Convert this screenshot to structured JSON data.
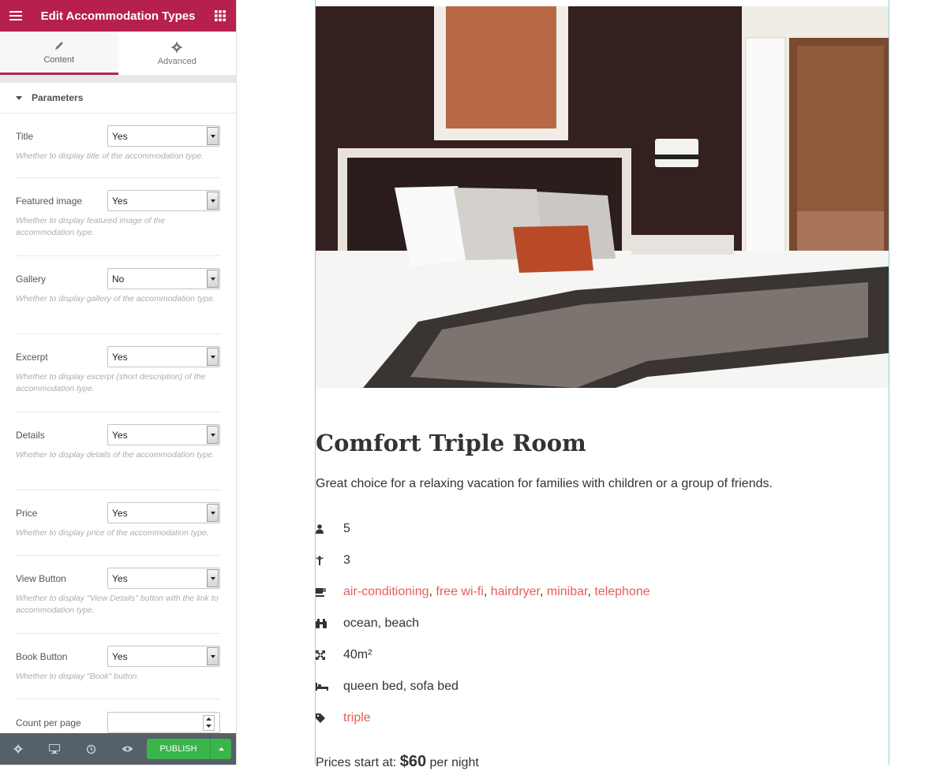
{
  "panel": {
    "title": "Edit Accommodation Types",
    "tabs": [
      {
        "label": "Content",
        "icon": "pencil-icon"
      },
      {
        "label": "Advanced",
        "icon": "gear-icon"
      }
    ],
    "section": "Parameters",
    "controls": [
      {
        "label": "Title",
        "value": "Yes",
        "desc": "Whether to display title of the accommodation type."
      },
      {
        "label": "Featured image",
        "value": "Yes",
        "desc": "Whether to display featured image of the accommodation type."
      },
      {
        "label": "Gallery",
        "value": "No",
        "desc": "Whether to display gallery of the accommodation type."
      },
      {
        "label": "Excerpt",
        "value": "Yes",
        "desc": "Whether to display excerpt (short description) of the accommodation type."
      },
      {
        "label": "Details",
        "value": "Yes",
        "desc": "Whether to display details of the accommodation type."
      },
      {
        "label": "Price",
        "value": "Yes",
        "desc": "Whether to display price of the accommodation type."
      },
      {
        "label": "View Button",
        "value": "Yes",
        "desc": "Whether to display \"View Details\" button with the link to accommodation type."
      },
      {
        "label": "Book Button",
        "value": "Yes",
        "desc": "Whether to display \"Book\" button."
      }
    ],
    "count_label": "Count per page",
    "publish_label": "PUBLISH"
  },
  "room": {
    "title": "Comfort Triple Room",
    "excerpt": "Great choice for a relaxing vacation for families with children or a group of friends.",
    "adults": "5",
    "children": "3",
    "amenities": [
      "air-conditioning",
      "free wi-fi",
      "hairdryer",
      "minibar",
      "telephone"
    ],
    "view": "ocean, beach",
    "size": "40m²",
    "beds": "queen bed, sofa bed",
    "category": "triple",
    "price_prefix": "Prices start at:",
    "price_value": "$60",
    "price_suffix": "per night"
  },
  "colors": {
    "brand": "#b6204f",
    "link": "#e85c5c",
    "publish": "#39b54a"
  }
}
